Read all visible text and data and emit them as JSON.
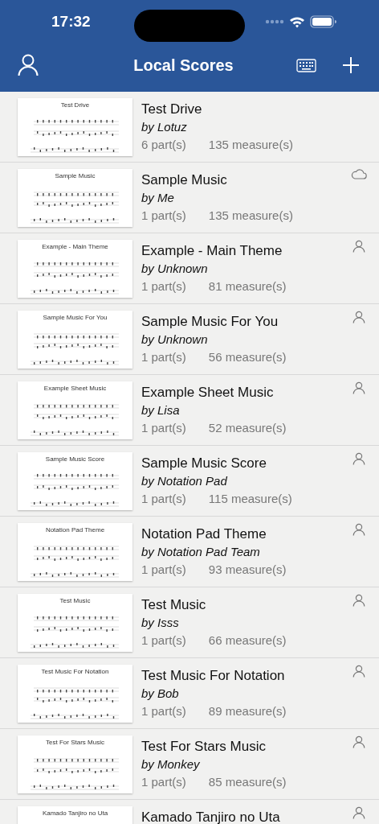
{
  "status_bar": {
    "time": "17:32"
  },
  "nav": {
    "title": "Local Scores"
  },
  "scores": [
    {
      "title": "Test Drive",
      "author": "by Lotuz",
      "parts": "6 part(s)",
      "measures": "135 measure(s)",
      "kind": "plain",
      "thumb_title": "Test Drive"
    },
    {
      "title": "Sample Music",
      "author": "by Me",
      "parts": "1 part(s)",
      "measures": "135 measure(s)",
      "kind": "cloud",
      "thumb_title": "Sample Music"
    },
    {
      "title": "Example - Main Theme",
      "author": "by Unknown",
      "parts": "1 part(s)",
      "measures": "81 measure(s)",
      "kind": "shared",
      "thumb_title": "Example - Main Theme"
    },
    {
      "title": "Sample Music For You",
      "author": "by Unknown",
      "parts": "1 part(s)",
      "measures": "56 measure(s)",
      "kind": "shared",
      "thumb_title": "Sample Music For You"
    },
    {
      "title": "Example Sheet Music",
      "author": "by Lisa",
      "parts": "1 part(s)",
      "measures": "52 measure(s)",
      "kind": "shared",
      "thumb_title": "Example Sheet Music"
    },
    {
      "title": "Sample Music Score",
      "author": "by Notation Pad",
      "parts": "1 part(s)",
      "measures": "115 measure(s)",
      "kind": "shared",
      "thumb_title": "Sample Music Score"
    },
    {
      "title": "Notation Pad Theme",
      "author": "by Notation Pad Team",
      "parts": "1 part(s)",
      "measures": "93 measure(s)",
      "kind": "shared",
      "thumb_title": "Notation Pad Theme"
    },
    {
      "title": "Test Music",
      "author": "by Isss",
      "parts": "1 part(s)",
      "measures": "66 measure(s)",
      "kind": "shared",
      "thumb_title": "Test Music"
    },
    {
      "title": "Test Music For Notation",
      "author": "by Bob",
      "parts": "1 part(s)",
      "measures": "89 measure(s)",
      "kind": "shared",
      "thumb_title": "Test Music For Notation"
    },
    {
      "title": "Test For Stars Music",
      "author": "by Monkey",
      "parts": "1 part(s)",
      "measures": "85 measure(s)",
      "kind": "shared",
      "thumb_title": "Test For Stars Music"
    },
    {
      "title": "Kamado Tanjiro no Uta",
      "kind": "shared",
      "thumb_title": "Kamado Tanjiro no Uta"
    }
  ]
}
